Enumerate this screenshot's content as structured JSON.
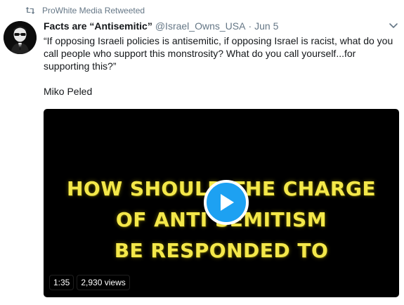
{
  "retweet": {
    "label": "ProWhite Media Retweeted",
    "icon": "retweet-icon"
  },
  "author": {
    "display_name": "Facts are “Antisemitic”",
    "handle": "@Israel_Owns_USA",
    "separator": "·",
    "time": "Jun 5",
    "avatar_icon": "avatar"
  },
  "tweet": {
    "text": "“If opposing Israeli policies is antisemitic, if opposing Israel is racist, what do you call people who support this monstrosity? What do you call yourself...for supporting this?”",
    "signature": "Miko Peled"
  },
  "video": {
    "title_lines": [
      "HOW SHOULD THE CHARGE",
      "OF ANTI SEMITISM",
      "BE RESPONDED TO"
    ],
    "duration": "1:35",
    "views": "2,930 views",
    "play_icon": "play-icon"
  },
  "colors": {
    "accent": "#1da1f2",
    "muted": "#657786",
    "text": "#14171a",
    "video_text": "#f4e84a"
  }
}
